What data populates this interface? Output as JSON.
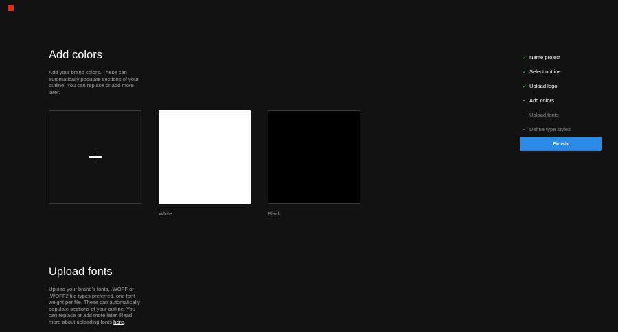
{
  "brand": {
    "logo_color": "#e8290b"
  },
  "colors_section": {
    "title": "Add colors",
    "description": "Add your brand colors. These can automatically populate sections of your outline. You can replace or add more later.",
    "swatches": [
      {
        "label": "White",
        "color": "#ffffff"
      },
      {
        "label": "Black",
        "color": "#000000"
      }
    ]
  },
  "fonts_section": {
    "title": "Upload fonts",
    "description": "Upload your brand's fonts, .WOFF or .WOFF2 file types preferred, one font weight per file. These can automatically populate sections of your outline. You can replace or add more later. Read more about uploading fonts",
    "link_label": "here",
    "trailing": "."
  },
  "steps": [
    {
      "label": "Name project",
      "status": "done",
      "icon": "check-icon"
    },
    {
      "label": "Select outline",
      "status": "done",
      "icon": "check-icon"
    },
    {
      "label": "Upload logo",
      "status": "done",
      "icon": "check-icon"
    },
    {
      "label": "Add colors",
      "status": "current",
      "icon": "dash-icon"
    },
    {
      "label": "Upload fonts",
      "status": "pending",
      "icon": "dash-icon"
    },
    {
      "label": "Define type styles",
      "status": "pending",
      "icon": "dash-icon"
    }
  ],
  "finish_button": {
    "label": "Finish",
    "color": "#2a8ae6"
  },
  "accent_colors": {
    "check": "#3ec95f"
  }
}
